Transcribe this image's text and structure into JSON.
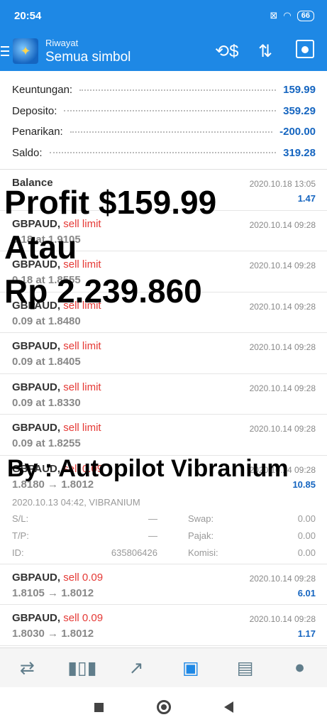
{
  "status_bar": {
    "time": "20:54",
    "battery": "66",
    "signal_icon": "sim-off-icon",
    "wifi_icon": "wifi-icon"
  },
  "app_bar": {
    "subtitle": "Riwayat",
    "title": "Semua simbol"
  },
  "summary": [
    {
      "label": "Keuntungan:",
      "value": "159.99"
    },
    {
      "label": "Deposito:",
      "value": "359.29"
    },
    {
      "label": "Penarikan:",
      "value": "-200.00"
    },
    {
      "label": "Saldo:",
      "value": "319.28"
    }
  ],
  "history": [
    {
      "symbol": "Balance",
      "type": "",
      "line2": "",
      "date": "2020.10.18 13:05",
      "amount": "1.47"
    },
    {
      "symbol": "GBPAUD,",
      "type": "sell limit",
      "line2": "0.18 at 1.9105",
      "date": "2020.10.14 09:28",
      "amount": ""
    },
    {
      "symbol": "GBPAUD,",
      "type": "sell limit",
      "line2": "0.18 at 1.8555",
      "date": "2020.10.14 09:28",
      "amount": ""
    },
    {
      "symbol": "GBPAUD,",
      "type": "sell limit",
      "line2": "0.09 at 1.8480",
      "date": "2020.10.14 09:28",
      "amount": ""
    },
    {
      "symbol": "GBPAUD,",
      "type": "sell limit",
      "line2": "0.09 at 1.8405",
      "date": "2020.10.14 09:28",
      "amount": ""
    },
    {
      "symbol": "GBPAUD,",
      "type": "sell limit",
      "line2": "0.09 at 1.8330",
      "date": "2020.10.14 09:28",
      "amount": ""
    },
    {
      "symbol": "GBPAUD,",
      "type": "sell limit",
      "line2": "0.09 at 1.8255",
      "date": "2020.10.14 09:28",
      "amount": ""
    }
  ],
  "expanded_trade": {
    "symbol": "GBPAUD,",
    "type": "sell 0.09",
    "line2": "1.8180 → 1.8012",
    "date": "2020.10.14 09:28",
    "amount": "10.85",
    "open_info": "2020.10.13 04:42, VIBRANIUM",
    "sl_label": "S/L:",
    "sl_value": "—",
    "tp_label": "T/P:",
    "tp_value": "—",
    "id_label": "ID:",
    "id_value": "635806426",
    "swap_label": "Swap:",
    "swap_value": "0.00",
    "tax_label": "Pajak:",
    "tax_value": "0.00",
    "commission_label": "Komisi:",
    "commission_value": "0.00"
  },
  "trades_after": [
    {
      "symbol": "GBPAUD,",
      "type": "sell 0.09",
      "line2": "1.8105 → 1.8012",
      "date": "2020.10.14 09:28",
      "amount": "6.01"
    },
    {
      "symbol": "GBPAUD,",
      "type": "sell 0.09",
      "line2": "1.8030 → 1.8012",
      "date": "2020.10.14 09:28",
      "amount": "1.17"
    }
  ],
  "overlay": {
    "line1": "Profit $159.99",
    "line2": "Atau",
    "line3": "Rp 2.239.860",
    "credit": "By : Autopilot Vibranium"
  },
  "bottom_nav": [
    "quotes-icon",
    "chart-icon",
    "trade-icon",
    "history-icon",
    "news-icon",
    "chat-icon"
  ],
  "colors": {
    "primary": "#1e88e5",
    "value_blue": "#1565c0",
    "sell_red": "#e53935"
  }
}
